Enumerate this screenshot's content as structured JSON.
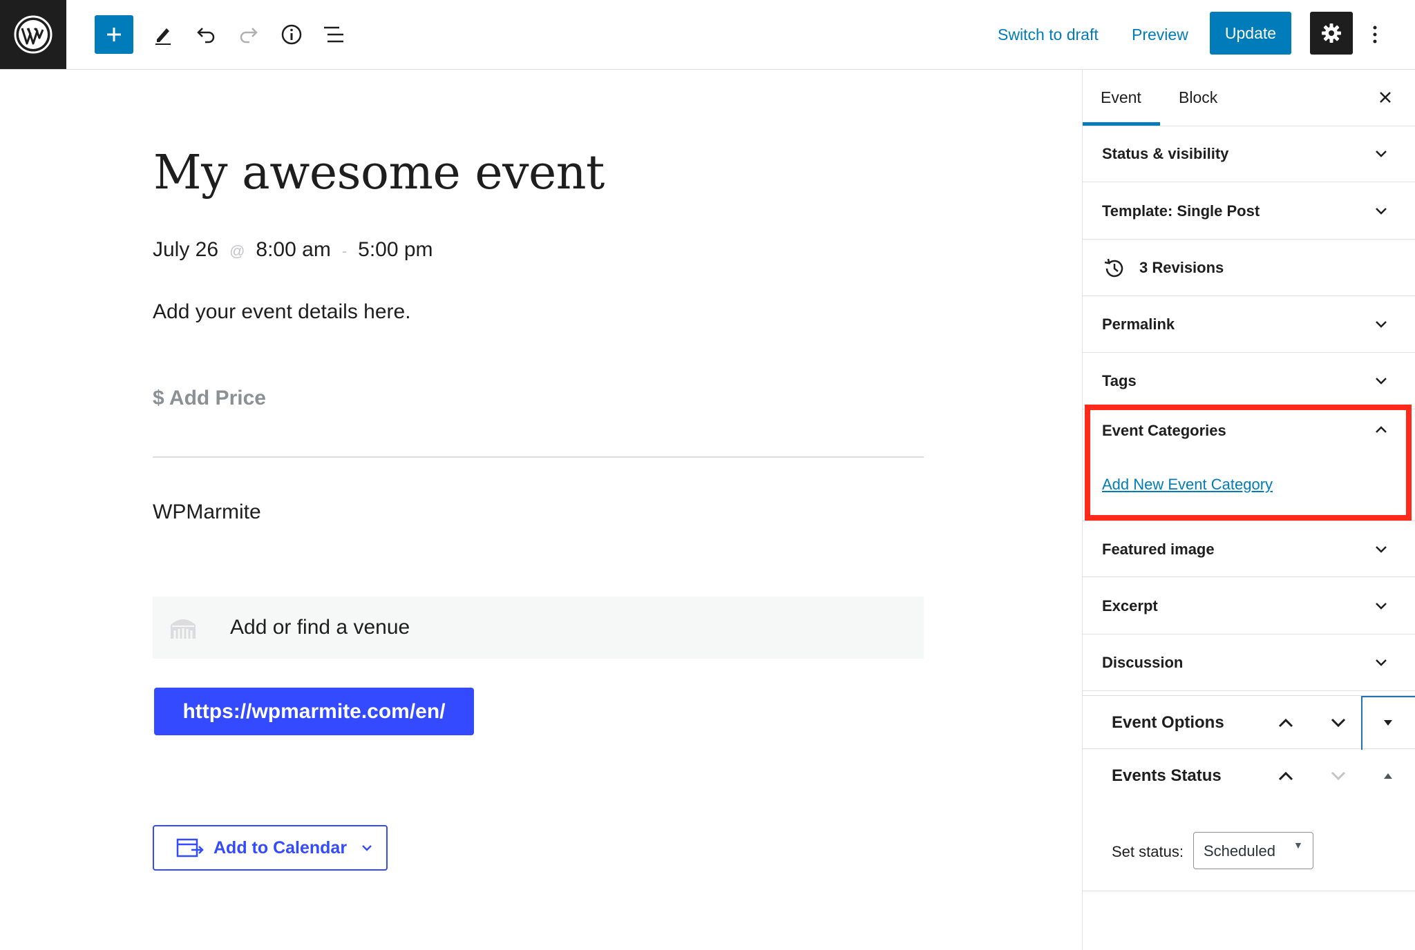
{
  "toolbar": {
    "switch_to_draft": "Switch to draft",
    "preview": "Preview",
    "update": "Update",
    "icons": [
      "wordpress-logo",
      "plus",
      "pencil",
      "undo",
      "redo",
      "info",
      "list-view",
      "gear",
      "more-vertical"
    ]
  },
  "post": {
    "title": "My awesome event",
    "date": "July 26",
    "at_symbol": "@",
    "start_time": "8:00 am",
    "dash": "-",
    "end_time": "5:00 pm",
    "details": "Add your event details here.",
    "price_placeholder": "$ Add Price",
    "organizer": "WPMarmite",
    "venue_placeholder": "Add or find a venue",
    "website_url": "https://wpmarmite.com/en/",
    "add_to_calendar": "Add to Calendar"
  },
  "sidebar": {
    "tabs": [
      "Event",
      "Block"
    ],
    "active_tab": "Event",
    "panels": {
      "status_visibility": "Status & visibility",
      "template": "Template: Single Post",
      "revisions": "3 Revisions",
      "permalink": "Permalink",
      "tags": "Tags",
      "event_categories": "Event Categories",
      "add_new_event_category": "Add New Event Category",
      "featured_image": "Featured image",
      "excerpt": "Excerpt",
      "discussion": "Discussion"
    },
    "meta_boxes": {
      "event_options": "Event Options",
      "events_status": "Events Status",
      "set_status_label": "Set status:",
      "status_value": "Scheduled"
    }
  },
  "colors": {
    "accent": "#007cba",
    "highlight_border": "#ff2a1a",
    "event_button": "#334aff",
    "dark": "#1e1e1e"
  }
}
